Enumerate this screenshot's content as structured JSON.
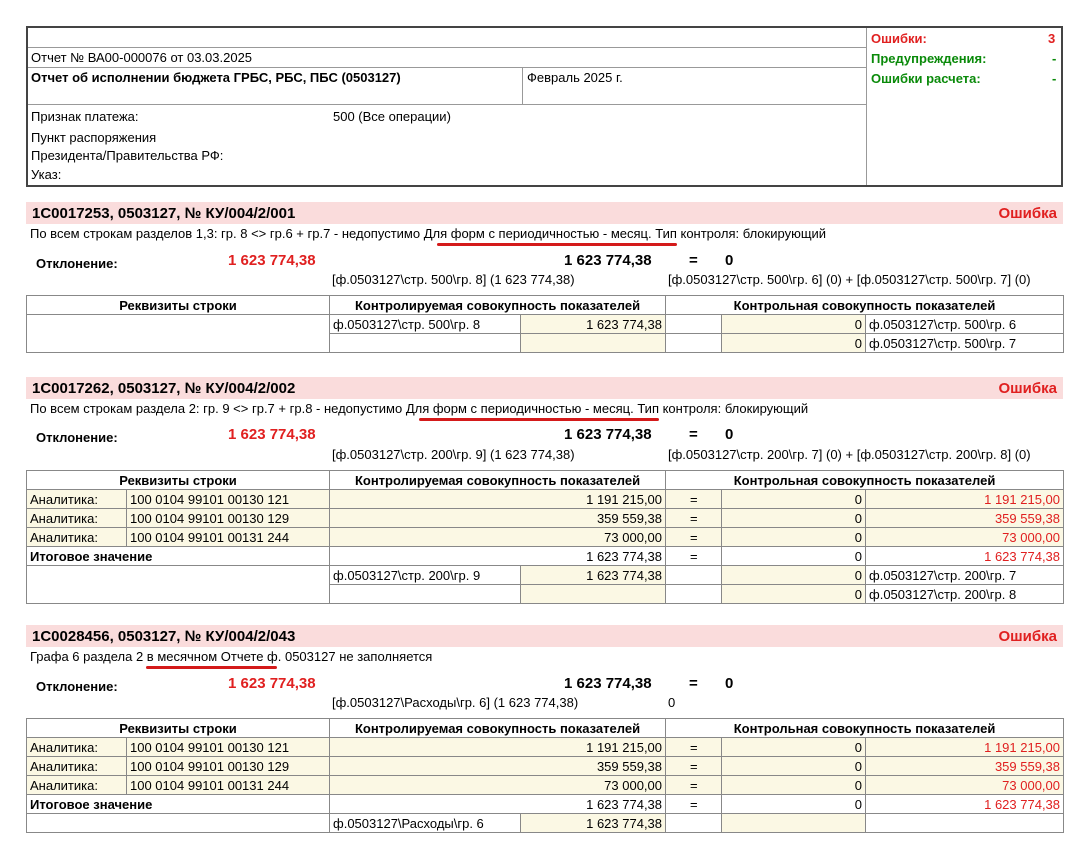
{
  "header": {
    "report_number": "Отчет № ВА00-000076 от 03.03.2025",
    "report_title": "Отчет об исполнении бюджета ГРБС, РБС, ПБС (0503127)",
    "period": "Февраль 2025 г.",
    "payment_sign_label": "Признак платежа:",
    "payment_sign_value": "500 (Все операции)",
    "order_label_1": "Пункт распоряжения",
    "order_label_2": "Президента/Правительства РФ:",
    "decree_label": "Указ:",
    "errors_label": "Ошибки:",
    "errors_value": "3",
    "warnings_label": "Предупреждения:",
    "warnings_value": "-",
    "calc_errors_label": "Ошибки расчета:",
    "calc_errors_value": "-"
  },
  "common": {
    "deviation_label": "Отклонение:",
    "status": "Ошибка",
    "col_requisites": "Реквизиты строки",
    "col_controlled": "Контролируемая совокупность показателей",
    "col_control": "Контрольная совокупность показателей",
    "eq": "=",
    "total_label": "Итоговое значение",
    "analytics_label": "Аналитика:"
  },
  "errors": [
    {
      "code": "1С0017253, 0503127, № КУ/004/2/001",
      "description_pre": "По всем строкам разделов 1,3: гр. 8 <> гр.6 + гр.7 - недопустимо ",
      "description_mid": "Для форм с периодичностью - месяц.",
      "description_post": " Тип контроля: блокирующий",
      "deviation": "1 623 774,38",
      "left_value": "1 623 774,38",
      "right_value": "0",
      "left_formula": "[ф.0503127\\стр. 500\\гр. 8] (1 623 774,38)",
      "right_formula": "[ф.0503127\\стр. 500\\гр. 6] (0)  +  [ф.0503127\\стр. 500\\гр. 7] (0)",
      "ref_rows": [
        {
          "ref": "ф.0503127\\стр. 500\\гр. 8",
          "value": "1 623 774,38",
          "ctrl_value": "0",
          "ctrl_ref": "ф.0503127\\стр. 500\\гр. 6"
        },
        {
          "ref": "",
          "value": "",
          "ctrl_value": "0",
          "ctrl_ref": "ф.0503127\\стр. 500\\гр. 7"
        }
      ]
    },
    {
      "code": "1С0017262, 0503127, № КУ/004/2/002",
      "description_pre": "По всем строкам раздела 2: гр. 9 <> гр.7 + гр.8 - недопустимо ",
      "description_mid": "Для форм с периодичностью - месяц.",
      "description_post": " Тип контроля: блокирующий",
      "deviation": "1 623 774,38",
      "left_value": "1 623 774,38",
      "right_value": "0",
      "left_formula": "[ф.0503127\\стр. 200\\гр. 9] (1 623 774,38)",
      "right_formula": "[ф.0503127\\стр. 200\\гр. 7] (0)  +  [ф.0503127\\стр. 200\\гр. 8] (0)",
      "analytics": [
        {
          "code": "100 0104 99101 00130 121",
          "value": "1 191 215,00",
          "ctrl": "0",
          "diff": "1 191 215,00"
        },
        {
          "code": "100 0104 99101 00130 129",
          "value": "359 559,38",
          "ctrl": "0",
          "diff": "359 559,38"
        },
        {
          "code": "100 0104 99101 00131 244",
          "value": "73 000,00",
          "ctrl": "0",
          "diff": "73 000,00"
        }
      ],
      "total": {
        "value": "1 623 774,38",
        "ctrl": "0",
        "diff": "1 623 774,38"
      },
      "ref_rows": [
        {
          "ref": "ф.0503127\\стр. 200\\гр. 9",
          "value": "1 623 774,38",
          "ctrl_value": "0",
          "ctrl_ref": "ф.0503127\\стр. 200\\гр. 7"
        },
        {
          "ref": "",
          "value": "",
          "ctrl_value": "0",
          "ctrl_ref": "ф.0503127\\стр. 200\\гр. 8"
        }
      ]
    },
    {
      "code": "1С0028456, 0503127, № КУ/004/2/043",
      "description_pre": "Графа 6 раздела 2 ",
      "description_mid": "в месячном Отчете",
      "description_post": " ф. 0503127 не заполняется",
      "deviation": "1 623 774,38",
      "left_value": "1 623 774,38",
      "right_value": "0",
      "left_formula": "[ф.0503127\\Расходы\\гр. 6] (1 623 774,38)",
      "right_formula": "0",
      "analytics": [
        {
          "code": "100 0104 99101 00130 121",
          "value": "1 191 215,00",
          "ctrl": "0",
          "diff": "1 191 215,00"
        },
        {
          "code": "100 0104 99101 00130 129",
          "value": "359 559,38",
          "ctrl": "0",
          "diff": "359 559,38"
        },
        {
          "code": "100 0104 99101 00131 244",
          "value": "73 000,00",
          "ctrl": "0",
          "diff": "73 000,00"
        }
      ],
      "total": {
        "value": "1 623 774,38",
        "ctrl": "0",
        "diff": "1 623 774,38"
      },
      "ref_rows": [
        {
          "ref": "ф.0503127\\Расходы\\гр. 6",
          "value": "1 623 774,38",
          "ctrl_value": "",
          "ctrl_ref": ""
        }
      ]
    }
  ]
}
